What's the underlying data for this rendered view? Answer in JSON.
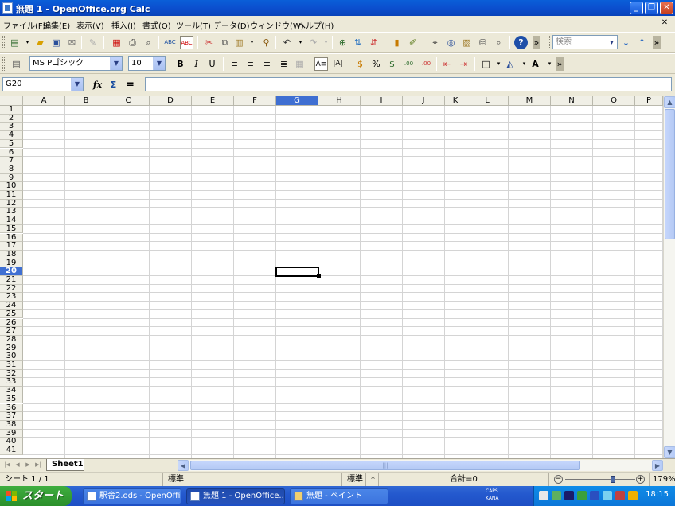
{
  "window": {
    "title": "無題 1 - OpenOffice.org Calc",
    "buttons": {
      "minimize": "_",
      "maximize": "❐",
      "close": "✕"
    }
  },
  "menu": {
    "items": [
      "ファイル(F)",
      "編集(E)",
      "表示(V)",
      "挿入(I)",
      "書式(O)",
      "ツール(T)",
      "データ(D)",
      "ウィンドウ(W)",
      "ヘルプ(H)"
    ],
    "doc_close": "✕"
  },
  "toolbar_standard": {
    "search_placeholder": "検索"
  },
  "toolbar_format": {
    "font_name": "MS Pゴシック",
    "font_size": "10",
    "bold": "B",
    "italic": "I",
    "underline": "U"
  },
  "formula_bar": {
    "name_box": "G20",
    "fx": "fx",
    "sum": "Σ",
    "equals": "=",
    "content": ""
  },
  "grid": {
    "columns": [
      "A",
      "B",
      "C",
      "D",
      "E",
      "F",
      "G",
      "H",
      "I",
      "J",
      "K",
      "L",
      "M",
      "N",
      "O",
      "P"
    ],
    "rows": [
      "1",
      "2",
      "3",
      "4",
      "5",
      "6",
      "7",
      "8",
      "9",
      "10",
      "11",
      "12",
      "13",
      "14",
      "15",
      "16",
      "17",
      "18",
      "19",
      "20",
      "21",
      "22",
      "23",
      "24",
      "25",
      "26",
      "27",
      "28",
      "29",
      "30",
      "31",
      "32",
      "33",
      "34",
      "35",
      "36",
      "37",
      "38",
      "39",
      "40",
      "41"
    ],
    "active_column": "G",
    "active_row": "20"
  },
  "sheets": {
    "tabs": [
      "Sheet1"
    ],
    "active": "Sheet1"
  },
  "status": {
    "sheet_position": "シート 1 / 1",
    "page_style": "標準",
    "mode": "標準",
    "insert_indicator": "*",
    "sum": "合計=0",
    "zoom": "179%",
    "zoom_minus": "−",
    "zoom_plus": "+"
  },
  "taskbar": {
    "start_label": "スタート",
    "tasks": [
      {
        "label": "駅舎2.ods - OpenOffi..."
      },
      {
        "label": "無題 1 - OpenOffice..."
      },
      {
        "label": "無題 - ペイント"
      }
    ],
    "ime_top": "CAPS",
    "ime_bottom": "KANA",
    "clock": "18:15"
  }
}
